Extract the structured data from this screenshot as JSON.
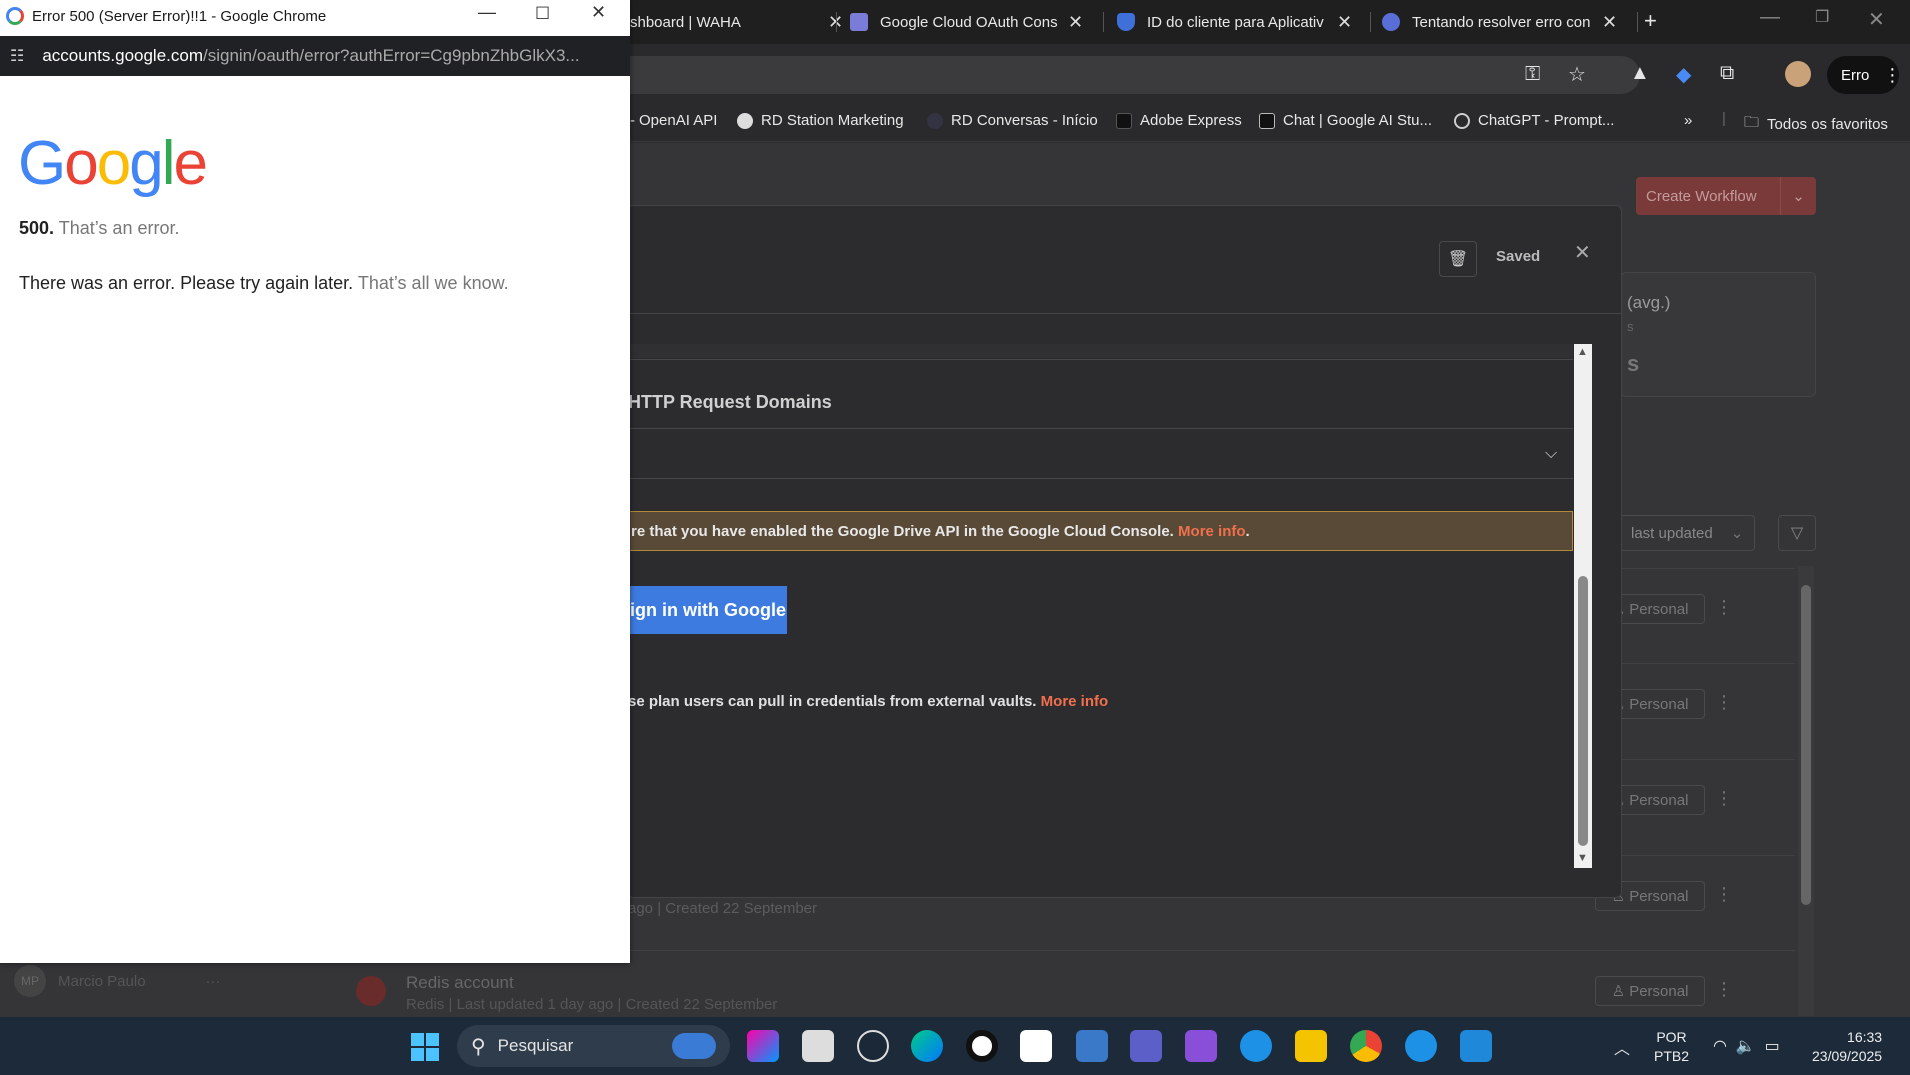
{
  "browser": {
    "tabs": [
      {
        "title": "shboard | WAHA"
      },
      {
        "title": "Google Cloud OAuth Cons"
      },
      {
        "title": "ID do cliente para Aplicativ"
      },
      {
        "title": "Tentando resolver erro con"
      }
    ],
    "profile_label": "Erro",
    "bookmarks": [
      "OpenAI API",
      "RD Station Marketing",
      "RD Conversas - Início",
      "Adobe Express",
      "Chat | Google AI Stu...",
      "ChatGPT - Prompt..."
    ],
    "all_bookmarks_label": "Todos os favoritos"
  },
  "app": {
    "create_workflow_label": "Create Workflow",
    "stat_label": "(avg.)",
    "stat_sub": "s",
    "stat_value": "s",
    "sort_label": "last updated",
    "row_badge_label": "Personal",
    "row_meta": "ago | Created 22 September",
    "redis_title": "Redis account",
    "redis_meta": "Redis | Last updated 1 day ago | Created 22 September",
    "user_initials": "MP",
    "user_name": "Marcio Paulo"
  },
  "modal": {
    "saved_label": "Saved",
    "section_heading": "HTTP Request Domains",
    "notice_text": "re that you have enabled the Google Drive API in the Google Cloud Console.",
    "notice_link": "More info",
    "signin_label": "ign in with Google",
    "vault_text": "se plan users can pull in credentials from external vaults.",
    "vault_link": "More info"
  },
  "popup": {
    "window_title": "Error 500 (Server Error)!!1 - Google Chrome",
    "url_host": "accounts.google.com",
    "url_path": "/signin/oauth/error?authError=Cg9pbnZhbGlkX3...",
    "logo_letters": [
      "G",
      "o",
      "o",
      "g",
      "l",
      "e"
    ],
    "error_code": "500.",
    "error_short": "That’s an error.",
    "error_message": "There was an error. Please try again later.",
    "error_tail": "That’s all we know."
  },
  "taskbar": {
    "search_placeholder": "Pesquisar",
    "lang_line1": "POR",
    "lang_line2": "PTB2",
    "time": "16:33",
    "date": "23/09/2025"
  },
  "colors": {
    "google_blue": "#4285f4",
    "google_red": "#ea4335",
    "google_yellow": "#fbbc05",
    "google_green": "#34a853",
    "link_orange": "#f0704d",
    "signin_blue": "#3e7be0"
  }
}
